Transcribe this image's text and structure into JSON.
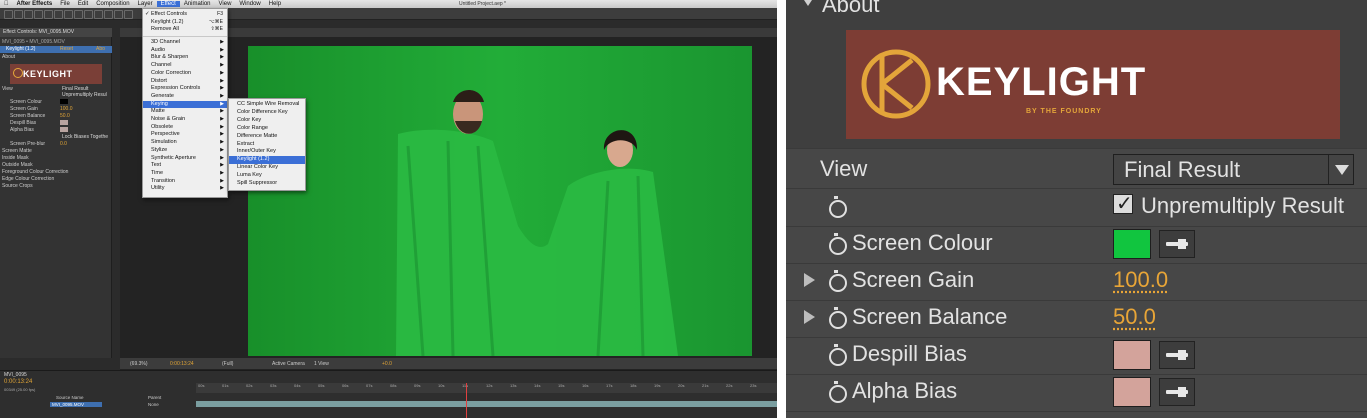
{
  "left_app": {
    "menubar": {
      "app_name": "After Effects",
      "items": [
        "File",
        "Edit",
        "Composition",
        "Layer",
        "Effect",
        "Animation",
        "View",
        "Window",
        "Help"
      ],
      "active_item": "Effect",
      "document_title": "Untitled Project.aep *"
    },
    "effect_controls": {
      "tab_label": "Effect Controls: MVI_0095.MOV",
      "breadcrumb": "MVI_0095 • MVI_0095.MOV",
      "effect_name": "Keylight (1.2)",
      "reset_label": "Reset",
      "about_label": "Abo",
      "about_section": "About",
      "logo_text": "KEYLIGHT",
      "rows": [
        {
          "label": "View",
          "value": "Final Result"
        },
        {
          "label": "",
          "value": "Unpremultiply Resul"
        },
        {
          "label": "Screen Colour",
          "value": ""
        },
        {
          "label": "Screen Gain",
          "value": "100.0"
        },
        {
          "label": "Screen Balance",
          "value": "50.0"
        },
        {
          "label": "Despill Bias",
          "value": ""
        },
        {
          "label": "Alpha Bias",
          "value": ""
        },
        {
          "label": "",
          "value": "Lock Biases Togethe"
        },
        {
          "label": "Screen Pre-blur",
          "value": "0.0"
        },
        {
          "label": "Screen Matte",
          "value": ""
        },
        {
          "label": "Inside Mask",
          "value": ""
        },
        {
          "label": "Outside Mask",
          "value": ""
        },
        {
          "label": "Foreground Colour Correction",
          "value": ""
        },
        {
          "label": "Edge Colour Correction",
          "value": ""
        },
        {
          "label": "Source Crops",
          "value": ""
        }
      ]
    },
    "effect_menu": {
      "items": [
        {
          "label": "Effect Controls",
          "shortcut": "F3",
          "checked": true,
          "submenu": false
        },
        {
          "label": "Keylight (1.2)",
          "shortcut": "⌥⌘E",
          "checked": false,
          "submenu": false
        },
        {
          "label": "Remove All",
          "shortcut": "⇧⌘E",
          "checked": false,
          "submenu": false
        },
        {
          "label": "3D Channel",
          "shortcut": "",
          "checked": false,
          "submenu": true
        },
        {
          "label": "Audio",
          "shortcut": "",
          "checked": false,
          "submenu": true
        },
        {
          "label": "Blur & Sharpen",
          "shortcut": "",
          "checked": false,
          "submenu": true
        },
        {
          "label": "Channel",
          "shortcut": "",
          "checked": false,
          "submenu": true
        },
        {
          "label": "Color Correction",
          "shortcut": "",
          "checked": false,
          "submenu": true
        },
        {
          "label": "Distort",
          "shortcut": "",
          "checked": false,
          "submenu": true
        },
        {
          "label": "Expression Controls",
          "shortcut": "",
          "checked": false,
          "submenu": true
        },
        {
          "label": "Generate",
          "shortcut": "",
          "checked": false,
          "submenu": true
        },
        {
          "label": "Keying",
          "shortcut": "",
          "checked": false,
          "submenu": true,
          "selected": true
        },
        {
          "label": "Matte",
          "shortcut": "",
          "checked": false,
          "submenu": true
        },
        {
          "label": "Noise & Grain",
          "shortcut": "",
          "checked": false,
          "submenu": true
        },
        {
          "label": "Obsolete",
          "shortcut": "",
          "checked": false,
          "submenu": true
        },
        {
          "label": "Perspective",
          "shortcut": "",
          "checked": false,
          "submenu": true
        },
        {
          "label": "Simulation",
          "shortcut": "",
          "checked": false,
          "submenu": true
        },
        {
          "label": "Stylize",
          "shortcut": "",
          "checked": false,
          "submenu": true
        },
        {
          "label": "Synthetic Aperture",
          "shortcut": "",
          "checked": false,
          "submenu": true
        },
        {
          "label": "Text",
          "shortcut": "",
          "checked": false,
          "submenu": true
        },
        {
          "label": "Time",
          "shortcut": "",
          "checked": false,
          "submenu": true
        },
        {
          "label": "Transition",
          "shortcut": "",
          "checked": false,
          "submenu": true
        },
        {
          "label": "Utility",
          "shortcut": "",
          "checked": false,
          "submenu": true
        }
      ]
    },
    "keying_submenu": {
      "items": [
        {
          "label": "CC Simple Wire Removal",
          "selected": false
        },
        {
          "label": "Color Difference Key",
          "selected": false
        },
        {
          "label": "Color Key",
          "selected": false
        },
        {
          "label": "Color Range",
          "selected": false
        },
        {
          "label": "Difference Matte",
          "selected": false
        },
        {
          "label": "Extract",
          "selected": false
        },
        {
          "label": "Inner/Outer Key",
          "selected": false
        },
        {
          "label": "Keylight (1.2)",
          "selected": true
        },
        {
          "label": "Linear Color Key",
          "selected": false
        },
        {
          "label": "Luma Key",
          "selected": false
        },
        {
          "label": "Spill Suppressor",
          "selected": false
        }
      ]
    },
    "viewer_bar": {
      "zoom": "(69.3%)",
      "timecode": "0:00:13:24",
      "resolution": "(Full)",
      "camera": "Active Camera",
      "views": "1 View",
      "exposure": "+0.0"
    },
    "timeline": {
      "comp_tab": "MVI_0095",
      "timecode": "0:00:13:24",
      "frame_info": "00349 (25.00 fps)",
      "source_name_header": "Source Name",
      "parent_header": "Parent",
      "layer_name": "MVI_0095.MOV",
      "parent_value": "None",
      "ruler_ticks": [
        "00s",
        "01s",
        "02s",
        "03s",
        "04s",
        "05s",
        "06s",
        "07s",
        "08s",
        "09s",
        "10s",
        "11s",
        "12s",
        "13s",
        "14s",
        "15s",
        "16s",
        "17s",
        "18s",
        "19s",
        "20s",
        "21s",
        "22s",
        "23s"
      ]
    }
  },
  "right_zoom": {
    "about_label": "About",
    "logo_title": "KEYLIGHT",
    "logo_subtitle": "BY THE FOUNDRY",
    "view_label": "View",
    "view_value": "Final Result",
    "unpremultiply_label": "Unpremultiply Result",
    "unpremultiply_checked": true,
    "screen_colour_label": "Screen Colour",
    "screen_colour": "#11c53f",
    "screen_gain_label": "Screen Gain",
    "screen_gain_value": "100.0",
    "screen_balance_label": "Screen Balance",
    "screen_balance_value": "50.0",
    "despill_bias_label": "Despill Bias",
    "despill_bias_colour": "#d3a39b",
    "alpha_bias_label": "Alpha Bias",
    "alpha_bias_colour": "#d3a39b"
  }
}
